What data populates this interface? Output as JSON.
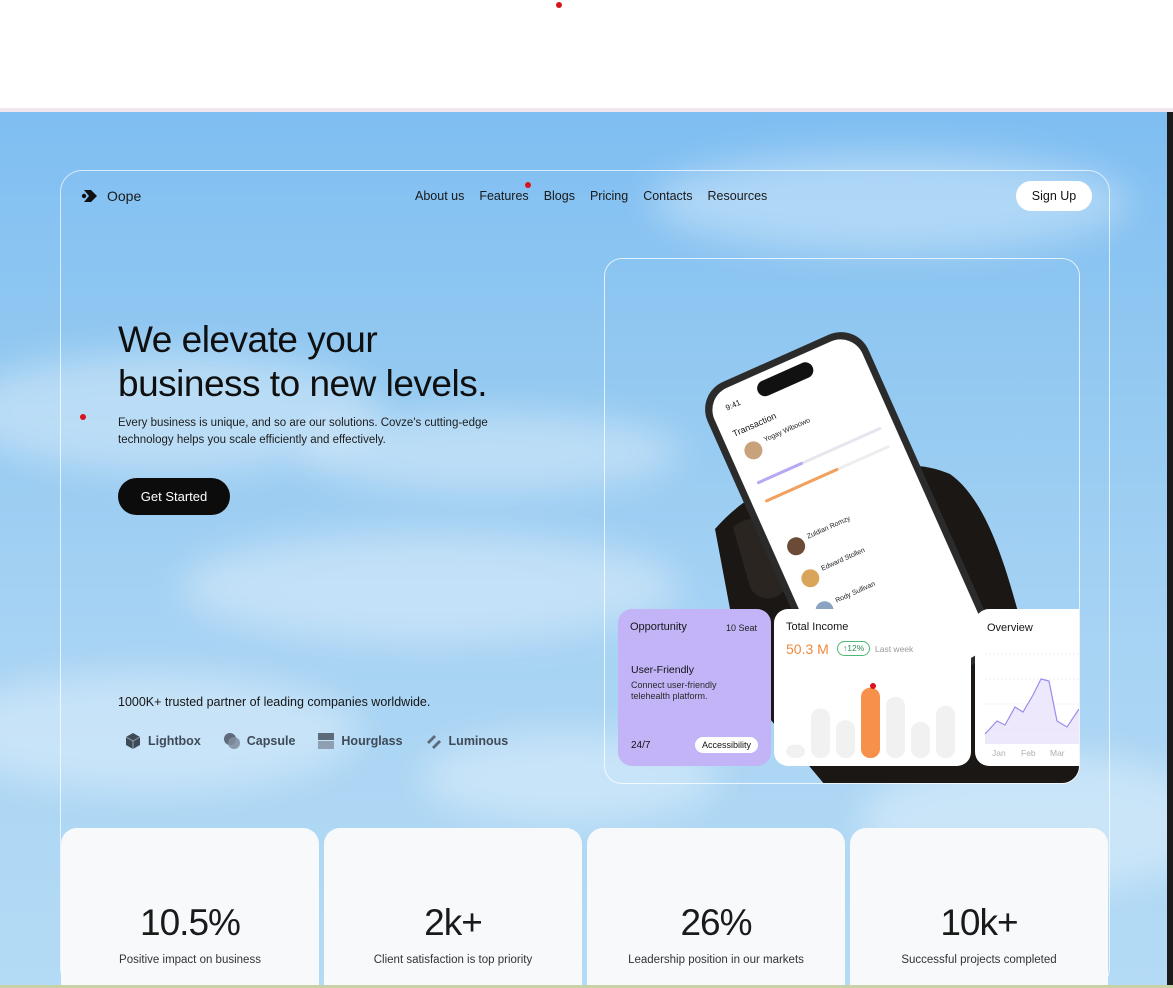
{
  "brand": {
    "name": "Oope"
  },
  "nav": {
    "items": [
      "About us",
      "Features",
      "Blogs",
      "Pricing",
      "Contacts",
      "Resources"
    ],
    "signup": "Sign Up"
  },
  "hero": {
    "headline_line1": "We elevate your",
    "headline_line2": "business to new levels.",
    "subtitle": "Every business is unique, and so are our solutions. Covze's cutting-edge technology helps you scale efficiently and effectively.",
    "cta": "Get Started"
  },
  "trusted": {
    "text": "1000K+ trusted partner of leading companies worldwide.",
    "brands": [
      "Lightbox",
      "Capsule",
      "Hourglass",
      "Luminous"
    ]
  },
  "cards": {
    "opportunity": {
      "title": "Opportunity",
      "seat": "10 Seat",
      "heading": "User-Friendly",
      "desc": "Connect user-friendly telehealth platform.",
      "hours": "24/7",
      "badge": "Accessibility"
    },
    "income": {
      "title": "Total Income",
      "value": "50.3 M",
      "change": "↑12%",
      "period": "Last week",
      "bars": [
        0.15,
        0.55,
        0.42,
        0.78,
        0.68,
        0.4,
        0.58
      ],
      "highlight_index": 3
    },
    "overview": {
      "title": "Overview",
      "months": [
        "Jan",
        "Feb",
        "Mar"
      ]
    }
  },
  "stats": [
    {
      "value": "10.5%",
      "label": "Positive impact on business"
    },
    {
      "value": "2k+",
      "label": "Client satisfaction is top priority"
    },
    {
      "value": "26%",
      "label": "Leadership position in our markets"
    },
    {
      "value": "10k+",
      "label": "Successful projects completed"
    }
  ],
  "phone": {
    "time": "9:41",
    "header": "Transaction",
    "contacts": [
      "Yogay Wiboowo",
      "Zuldian Romzy",
      "Edward Stollen",
      "Rody Sullivan"
    ]
  },
  "colors": {
    "accent_orange": "#f7904a",
    "card_purple": "#c2b4f7",
    "dark": "#0c0c0c"
  }
}
